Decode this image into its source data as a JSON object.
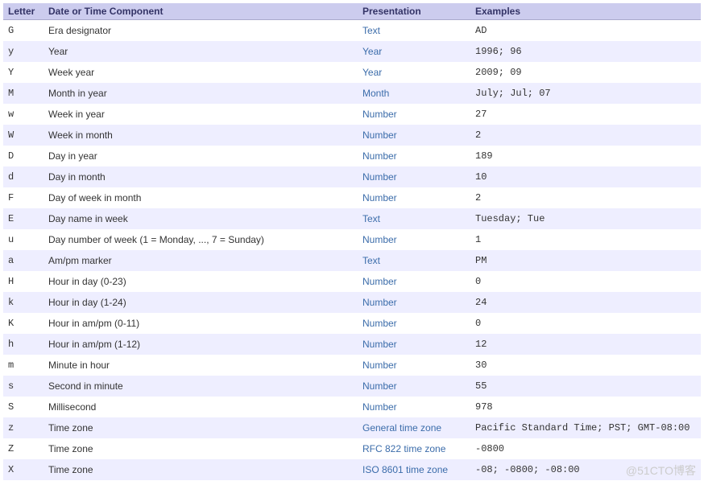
{
  "columns": {
    "letter": "Letter",
    "component": "Date or Time Component",
    "presentation": "Presentation",
    "examples": "Examples"
  },
  "rows": [
    {
      "letter": "G",
      "component": "Era designator",
      "presentation": "Text",
      "examples": "AD"
    },
    {
      "letter": "y",
      "component": "Year",
      "presentation": "Year",
      "examples": "1996; 96"
    },
    {
      "letter": "Y",
      "component": "Week year",
      "presentation": "Year",
      "examples": "2009; 09"
    },
    {
      "letter": "M",
      "component": "Month in year",
      "presentation": "Month",
      "examples": "July; Jul; 07"
    },
    {
      "letter": "w",
      "component": "Week in year",
      "presentation": "Number",
      "examples": "27"
    },
    {
      "letter": "W",
      "component": "Week in month",
      "presentation": "Number",
      "examples": "2"
    },
    {
      "letter": "D",
      "component": "Day in year",
      "presentation": "Number",
      "examples": "189"
    },
    {
      "letter": "d",
      "component": "Day in month",
      "presentation": "Number",
      "examples": "10"
    },
    {
      "letter": "F",
      "component": "Day of week in month",
      "presentation": "Number",
      "examples": "2"
    },
    {
      "letter": "E",
      "component": "Day name in week",
      "presentation": "Text",
      "examples": "Tuesday; Tue"
    },
    {
      "letter": "u",
      "component": "Day number of week (1 = Monday, ..., 7 = Sunday)",
      "presentation": "Number",
      "examples": "1"
    },
    {
      "letter": "a",
      "component": "Am/pm marker",
      "presentation": "Text",
      "examples": "PM"
    },
    {
      "letter": "H",
      "component": "Hour in day (0-23)",
      "presentation": "Number",
      "examples": "0"
    },
    {
      "letter": "k",
      "component": "Hour in day (1-24)",
      "presentation": "Number",
      "examples": "24"
    },
    {
      "letter": "K",
      "component": "Hour in am/pm (0-11)",
      "presentation": "Number",
      "examples": "0"
    },
    {
      "letter": "h",
      "component": "Hour in am/pm (1-12)",
      "presentation": "Number",
      "examples": "12"
    },
    {
      "letter": "m",
      "component": "Minute in hour",
      "presentation": "Number",
      "examples": "30"
    },
    {
      "letter": "s",
      "component": "Second in minute",
      "presentation": "Number",
      "examples": "55"
    },
    {
      "letter": "S",
      "component": "Millisecond",
      "presentation": "Number",
      "examples": "978"
    },
    {
      "letter": "z",
      "component": "Time zone",
      "presentation": "General time zone",
      "examples": "Pacific Standard Time; PST; GMT-08:00"
    },
    {
      "letter": "Z",
      "component": "Time zone",
      "presentation": "RFC 822 time zone",
      "examples": "-0800"
    },
    {
      "letter": "X",
      "component": "Time zone",
      "presentation": "ISO 8601 time zone",
      "examples": "-08; -0800; -08:00"
    }
  ],
  "watermark": "@51CTO博客"
}
